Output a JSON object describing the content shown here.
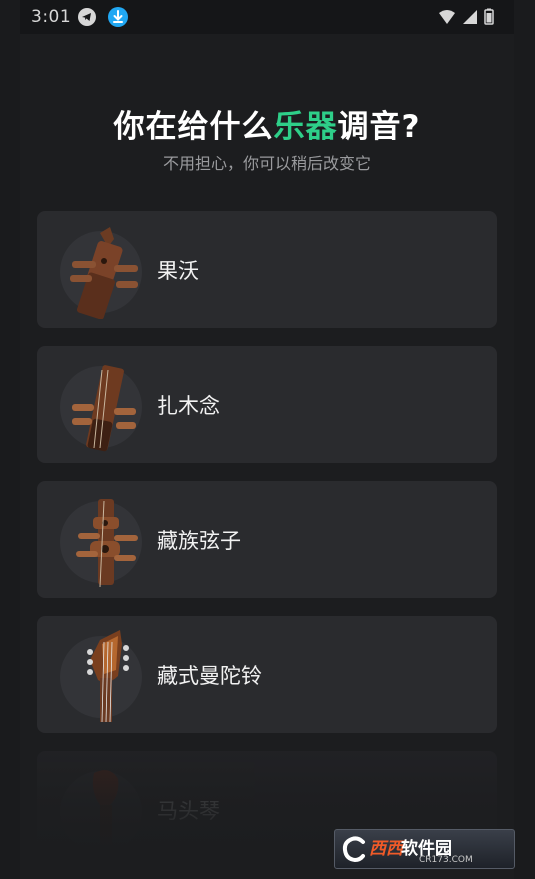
{
  "status_bar": {
    "time": "3:01"
  },
  "header": {
    "title_before": "你在给什么",
    "title_accent": "乐器",
    "title_after": "调音?",
    "subtitle": "不用担心，你可以稍后改变它"
  },
  "instruments": [
    {
      "name": "果沃"
    },
    {
      "name": "扎木念"
    },
    {
      "name": "藏族弦子"
    },
    {
      "name": "藏式曼陀铃"
    },
    {
      "name": "马头琴"
    }
  ],
  "watermark": {
    "brand": "西西",
    "suffix": "软件园",
    "url": "CR173.COM"
  },
  "colors": {
    "accent": "#2ecf89",
    "background": "#1c1d1f",
    "card": "#2a2b2e"
  }
}
